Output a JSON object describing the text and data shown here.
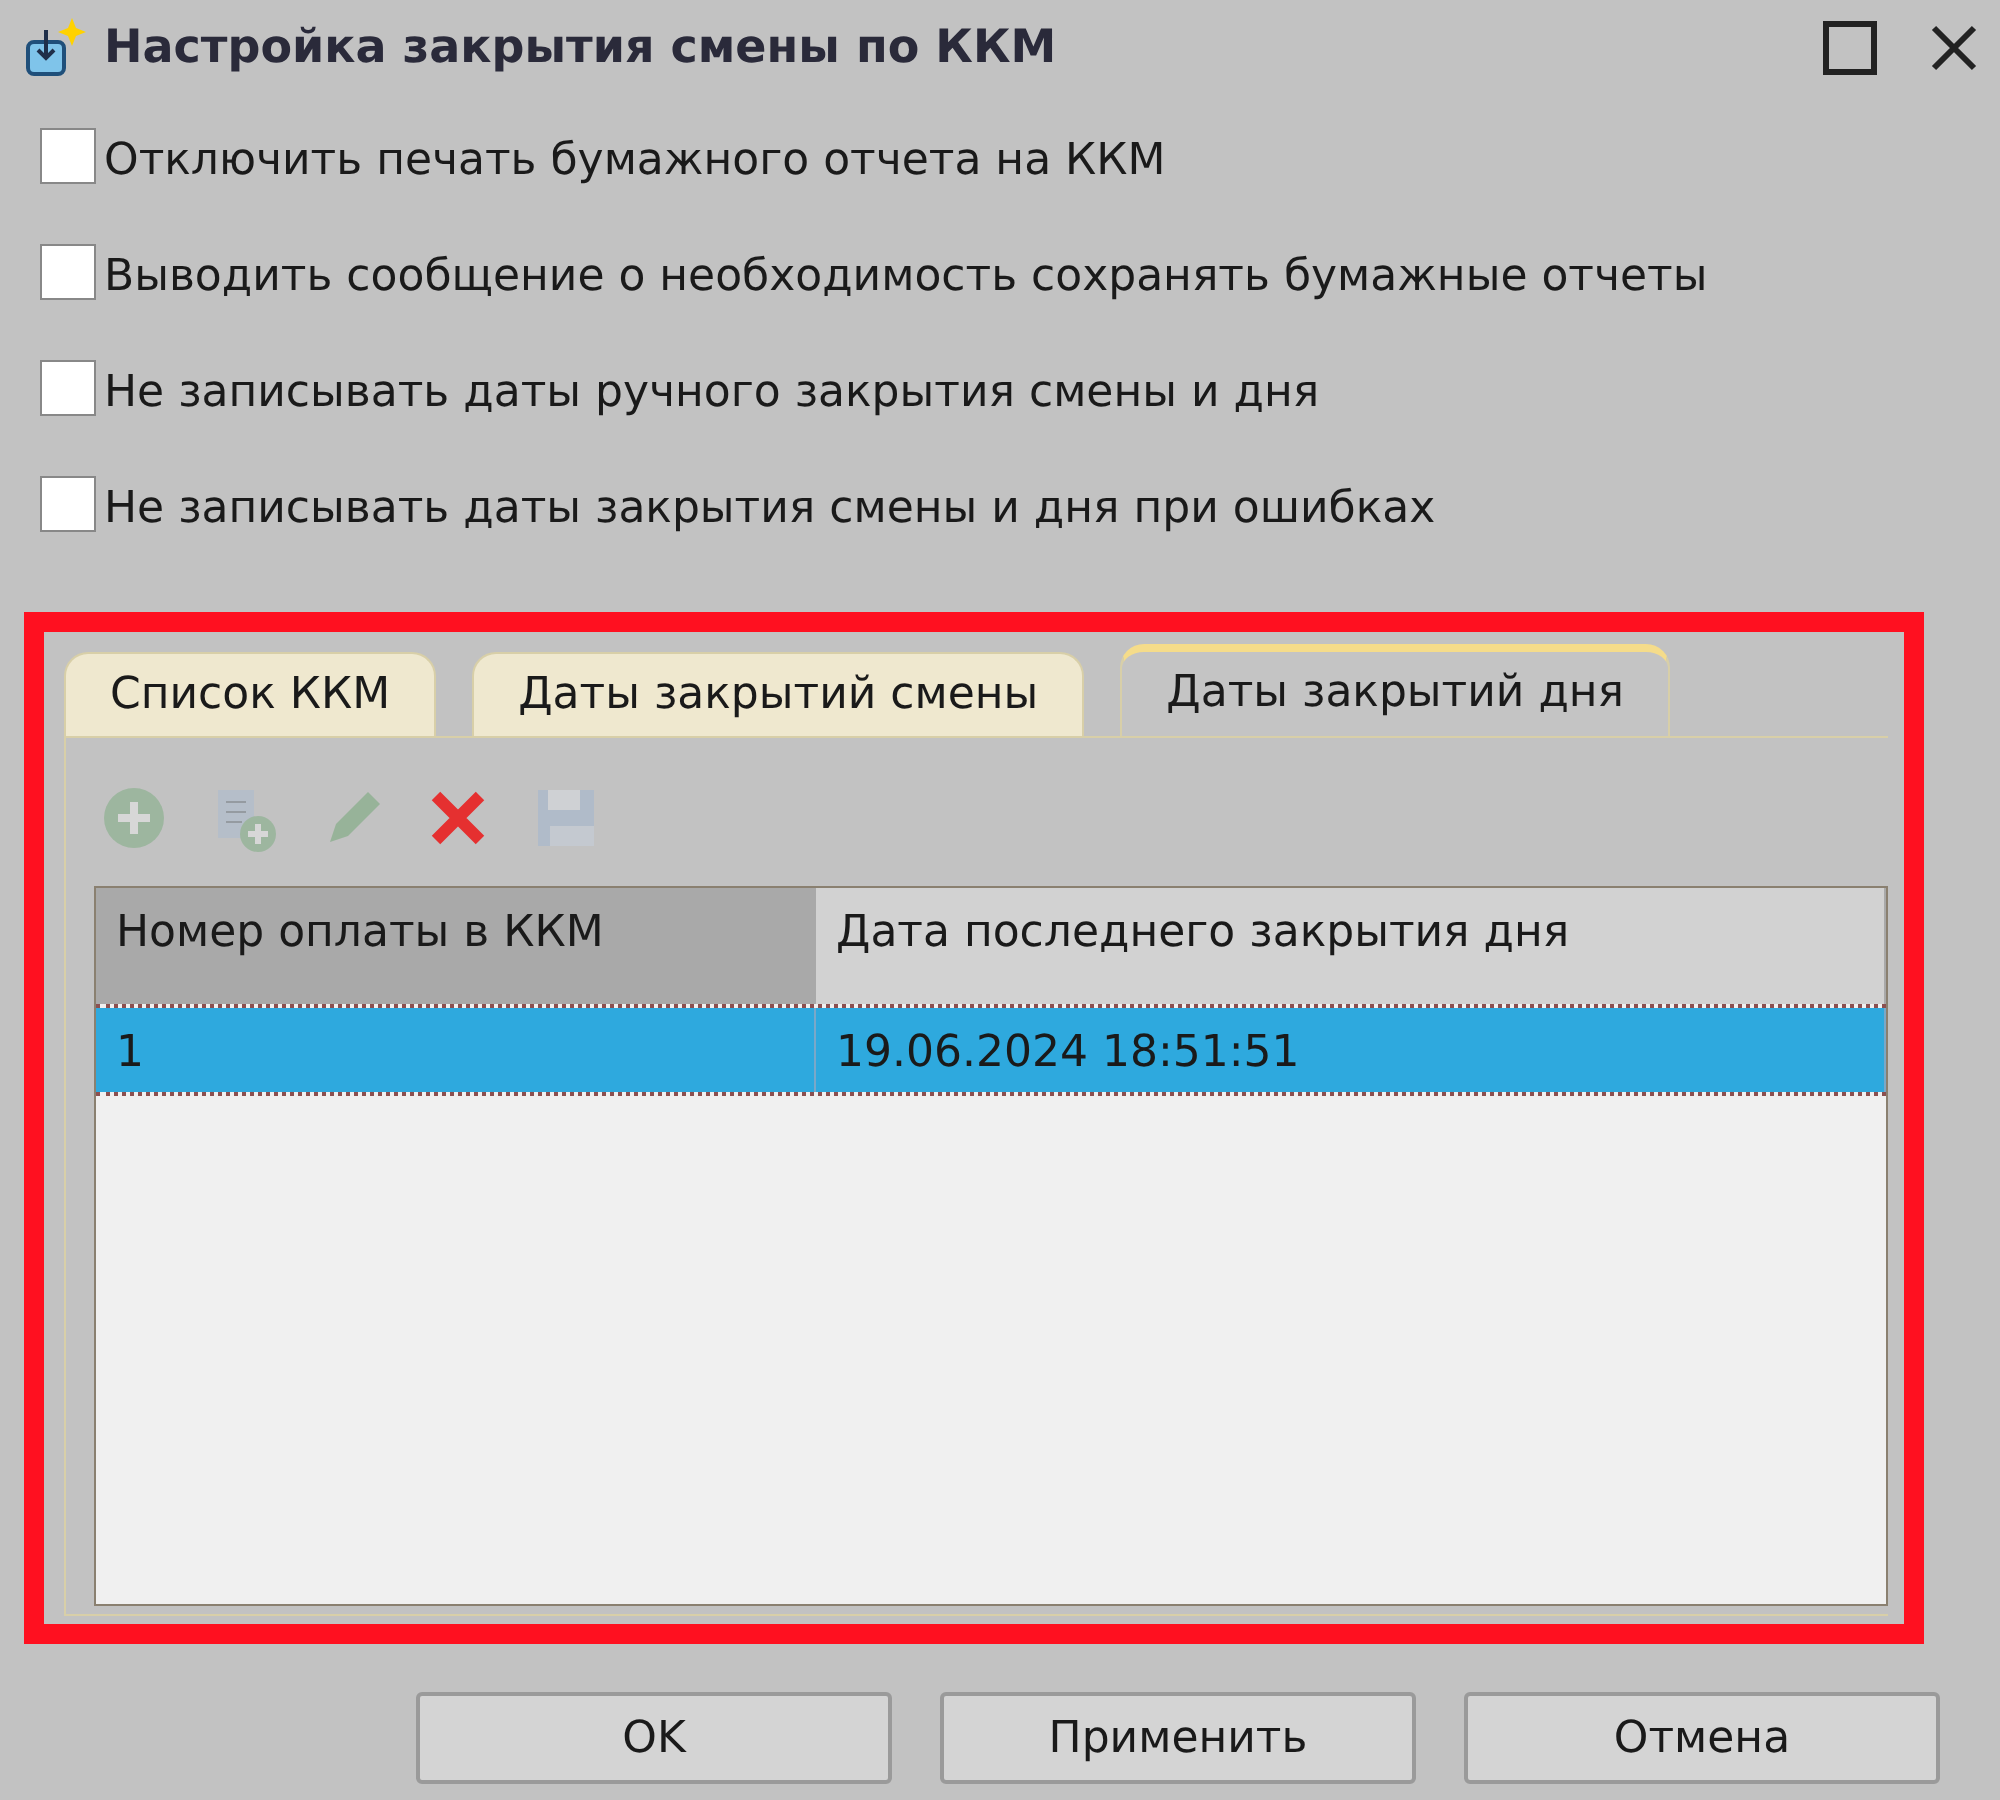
{
  "window": {
    "title": "Настройка закрытия смены по ККМ"
  },
  "options": [
    {
      "label": "Отключить печать бумажного отчета на ККМ",
      "checked": false
    },
    {
      "label": "Выводить сообщение о необходимость сохранять бумажные отчеты",
      "checked": false
    },
    {
      "label": "Не записывать даты ручного закрытия смены и дня",
      "checked": false
    },
    {
      "label": "Не записывать даты закрытия смены и дня при ошибках",
      "checked": false
    }
  ],
  "tab_panel": {
    "highlighted": true,
    "tabs": [
      {
        "label": "Список ККМ",
        "selected": false
      },
      {
        "label": "Даты закрытий смены",
        "selected": false
      },
      {
        "label": "Даты закрытий дня",
        "selected": true
      }
    ],
    "toolbar": [
      {
        "kind": "add",
        "disabled": true
      },
      {
        "kind": "copy",
        "disabled": true
      },
      {
        "kind": "edit",
        "disabled": true
      },
      {
        "kind": "delete",
        "disabled": false
      },
      {
        "kind": "save",
        "disabled": true
      }
    ],
    "table": {
      "columns": [
        "Номер оплаты в ККМ",
        "Дата последнего закрытия дня"
      ],
      "rows": [
        {
          "cells": [
            "1",
            "19.06.2024 18:51:51"
          ],
          "selected": true
        }
      ]
    }
  },
  "buttons": [
    "OK",
    "Применить",
    "Отмена"
  ]
}
